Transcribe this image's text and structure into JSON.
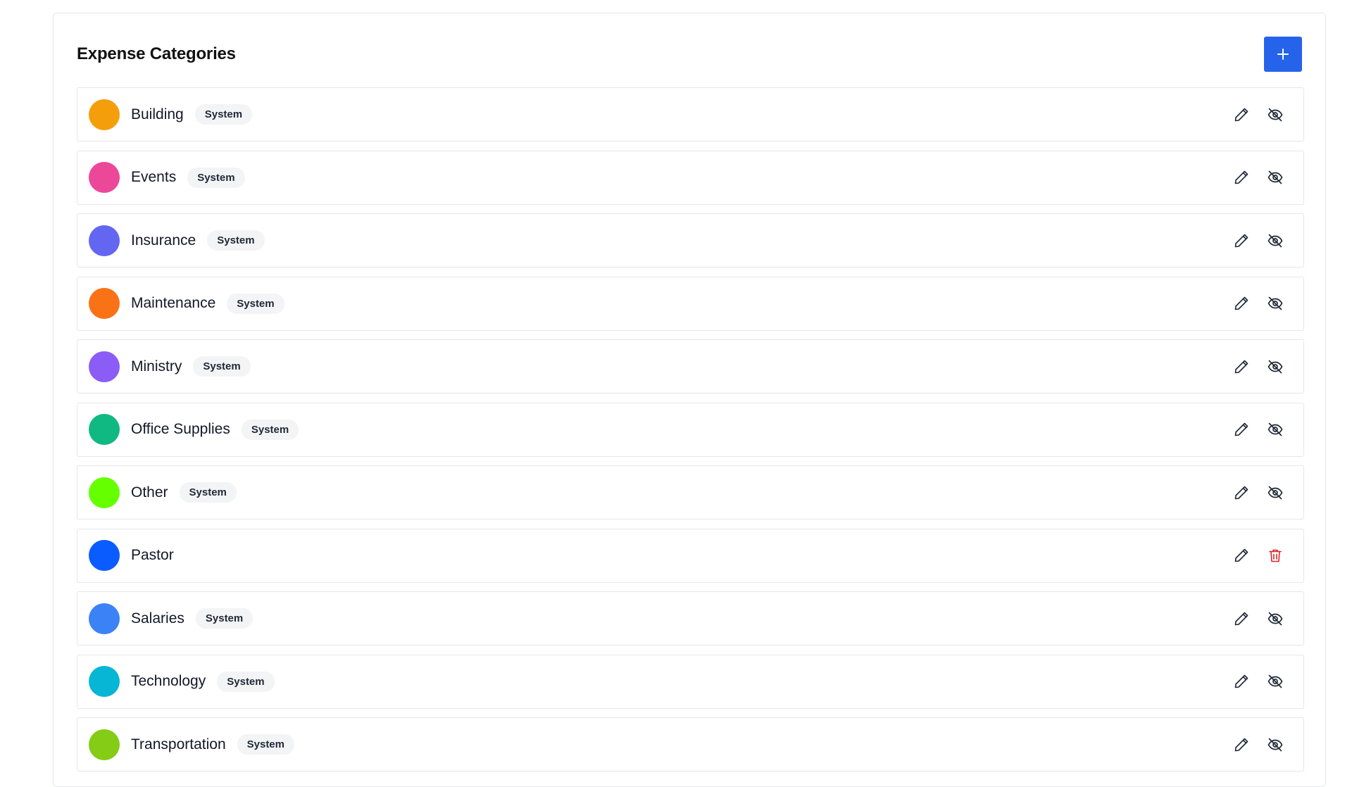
{
  "header": {
    "title": "Expense Categories",
    "add_icon": "plus-icon"
  },
  "colors": {
    "accent": "#2563eb",
    "delete": "#dc2626"
  },
  "categories": [
    {
      "name": "Building",
      "badge": "System",
      "color": "#f59e0b",
      "system": true
    },
    {
      "name": "Events",
      "badge": "System",
      "color": "#ec4899",
      "system": true
    },
    {
      "name": "Insurance",
      "badge": "System",
      "color": "#6366f1",
      "system": true
    },
    {
      "name": "Maintenance",
      "badge": "System",
      "color": "#f97316",
      "system": true
    },
    {
      "name": "Ministry",
      "badge": "System",
      "color": "#8b5cf6",
      "system": true
    },
    {
      "name": "Office Supplies",
      "badge": "System",
      "color": "#10b981",
      "system": true
    },
    {
      "name": "Other",
      "badge": "System",
      "color": "#66ff00",
      "system": true
    },
    {
      "name": "Pastor",
      "badge": "",
      "color": "#0b5cff",
      "system": false
    },
    {
      "name": "Salaries",
      "badge": "System",
      "color": "#3b82f6",
      "system": true
    },
    {
      "name": "Technology",
      "badge": "System",
      "color": "#06b6d4",
      "system": true
    },
    {
      "name": "Transportation",
      "badge": "System",
      "color": "#84cc16",
      "system": true
    }
  ]
}
